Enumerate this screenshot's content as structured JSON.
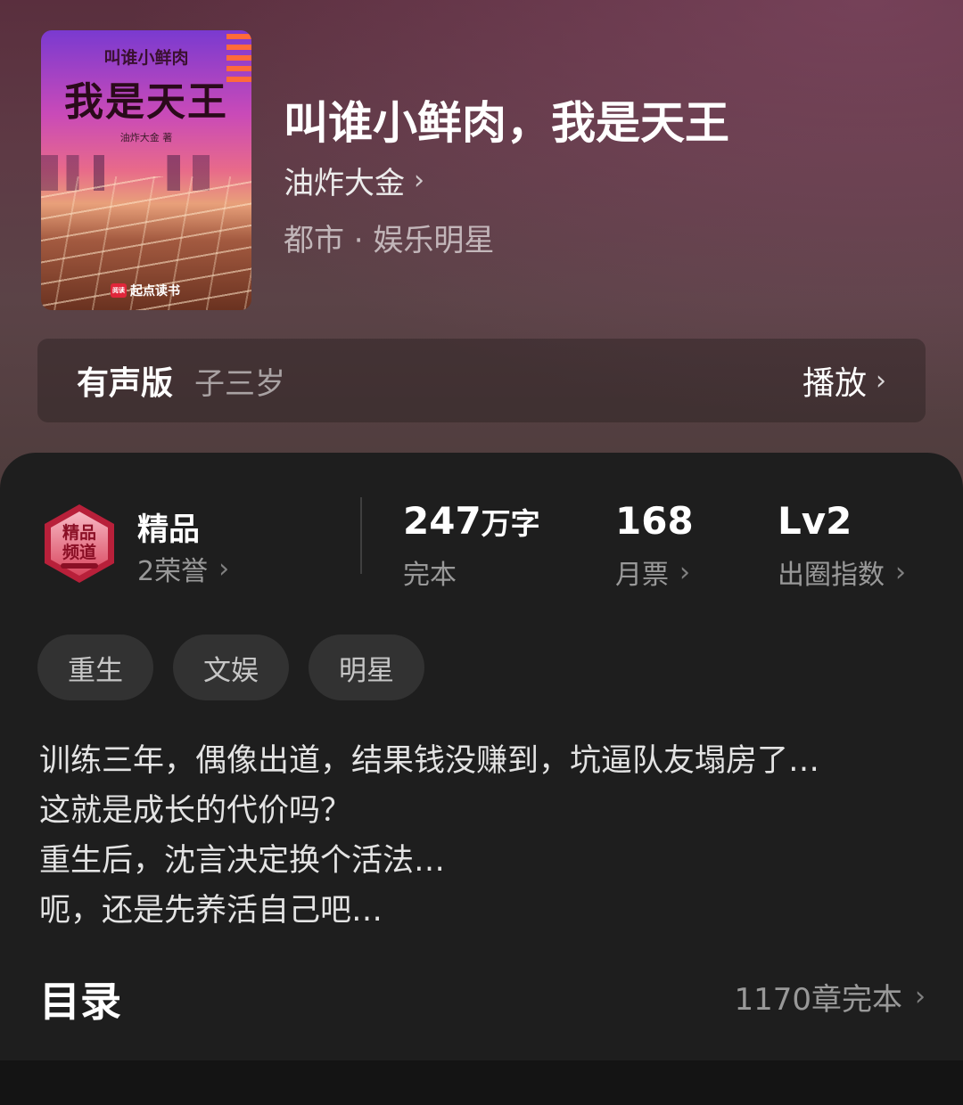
{
  "cover": {
    "subtitle": "叫谁小鲜肉",
    "title": "我是天王",
    "author_credit": "油炸大金 著",
    "publisher_logo": "阅读",
    "publisher": "起点读书"
  },
  "book": {
    "title": "叫谁小鲜肉，我是天王",
    "author": "油炸大金",
    "genre": "都市 · 娱乐明星"
  },
  "audio": {
    "label": "有声版",
    "narrator": "子三岁",
    "play_label": "播放"
  },
  "stats": {
    "quality_title": "精品",
    "honors": "2荣誉",
    "word_count_number": "247",
    "word_count_unit": "万字",
    "status": "完本",
    "monthly_tickets": "168",
    "monthly_tickets_label": "月票",
    "influence_level": "Lv2",
    "influence_label": "出圈指数"
  },
  "tags": [
    "重生",
    "文娱",
    "明星"
  ],
  "synopsis": [
    "训练三年，偶像出道，结果钱没赚到，坑逼队友塌房了…",
    "这就是成长的代价吗？",
    "重生后，沈言决定换个活法…",
    "呃，还是先养活自己吧…"
  ],
  "toc": {
    "label": "目录",
    "info": "1170章完本"
  },
  "badge": {
    "line1": "精品",
    "line2": "频道"
  },
  "icons": {
    "chevron": "chevron-right-icon",
    "badge": "quality-channel-badge-icon"
  },
  "colors": {
    "panel_bg": "#1e1e1e",
    "tag_bg": "#323232",
    "badge_red": "#b8203a"
  }
}
